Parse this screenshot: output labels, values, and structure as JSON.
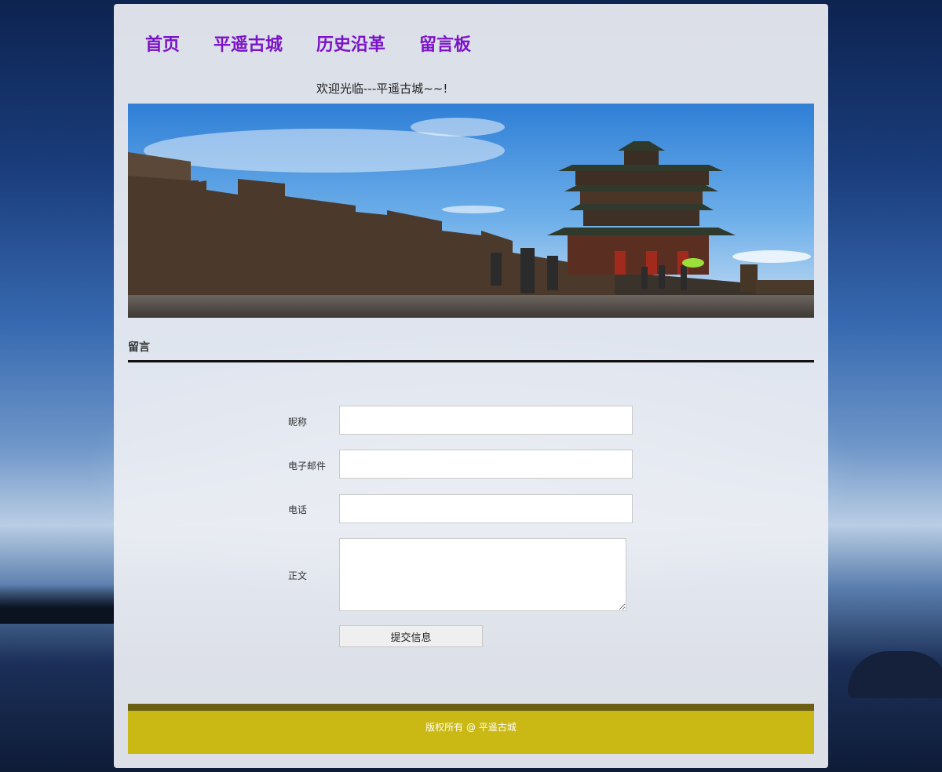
{
  "nav": {
    "items": [
      {
        "label": "首页"
      },
      {
        "label": "平遥古城"
      },
      {
        "label": "历史沿革"
      },
      {
        "label": "留言板"
      }
    ]
  },
  "welcome": "欢迎光临---平遥古城~~!",
  "banner": {
    "icon": "ancient-city-wall-image"
  },
  "section": {
    "title": "留言"
  },
  "form": {
    "nickname_label": "昵称",
    "email_label": "电子邮件",
    "phone_label": "电话",
    "body_label": "正文",
    "nickname_value": "",
    "email_value": "",
    "phone_value": "",
    "body_value": "",
    "submit_label": "提交信息"
  },
  "footer": {
    "text": "版权所有 @ 平遥古城"
  },
  "colors": {
    "nav_link": "#7b13c9",
    "footer_bg": "#cab814",
    "footer_bar": "#6a5f12"
  }
}
